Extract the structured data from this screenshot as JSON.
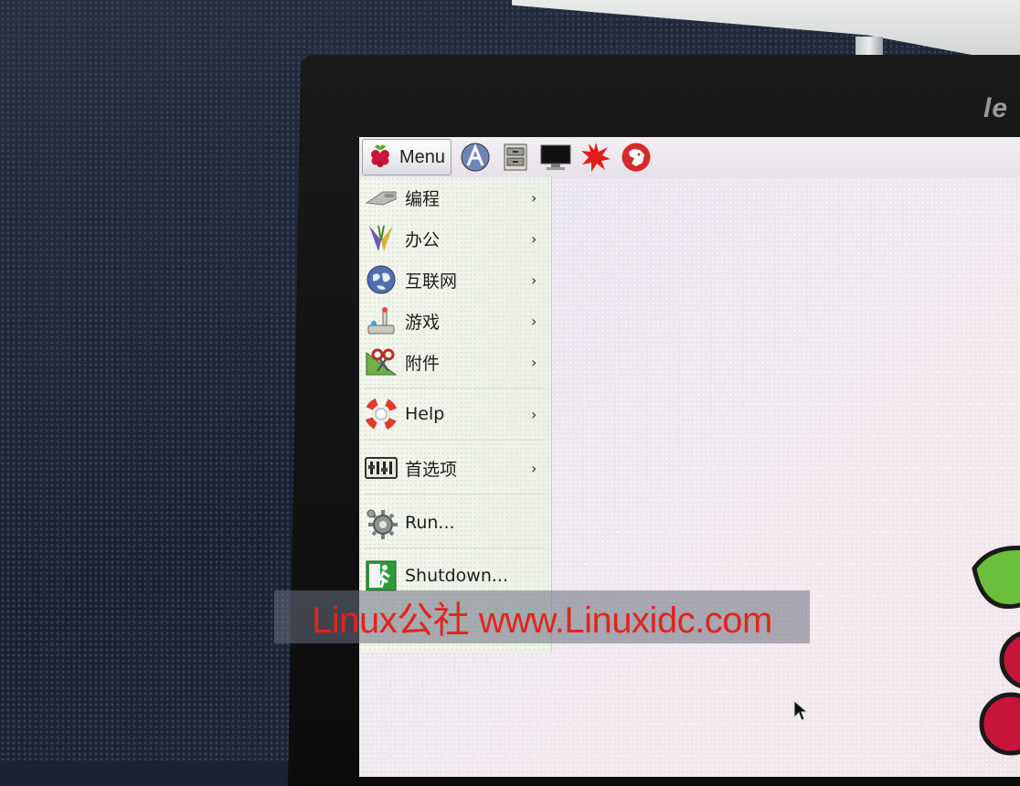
{
  "taskbar": {
    "menu_label": "Menu",
    "launchers": [
      "web-browser-icon",
      "file-manager-icon",
      "terminal-icon",
      "mathematica-icon",
      "wolfram-icon"
    ]
  },
  "menu": {
    "items": [
      {
        "label": "编程",
        "icon": "programming-icon",
        "submenu": true
      },
      {
        "label": "办公",
        "icon": "office-icon",
        "submenu": true
      },
      {
        "label": "互联网",
        "icon": "internet-icon",
        "submenu": true
      },
      {
        "label": "游戏",
        "icon": "games-icon",
        "submenu": true
      },
      {
        "label": "附件",
        "icon": "accessories-icon",
        "submenu": true
      },
      {
        "label": "Help",
        "icon": "help-lifebuoy-icon",
        "submenu": true
      },
      {
        "label": "首选项",
        "icon": "preferences-icon",
        "submenu": true
      },
      {
        "label": "Run...",
        "icon": "run-gear-icon",
        "submenu": false
      },
      {
        "label": "Shutdown...",
        "icon": "shutdown-exit-icon",
        "submenu": false
      }
    ],
    "arrow": "›"
  },
  "monitor_brand": "le",
  "watermark": "Linux公社 www.Linuxidc.com",
  "colors": {
    "watermark_text": "#e0251d",
    "raspberry": "#c7153a",
    "leaf": "#6bbf3a"
  }
}
